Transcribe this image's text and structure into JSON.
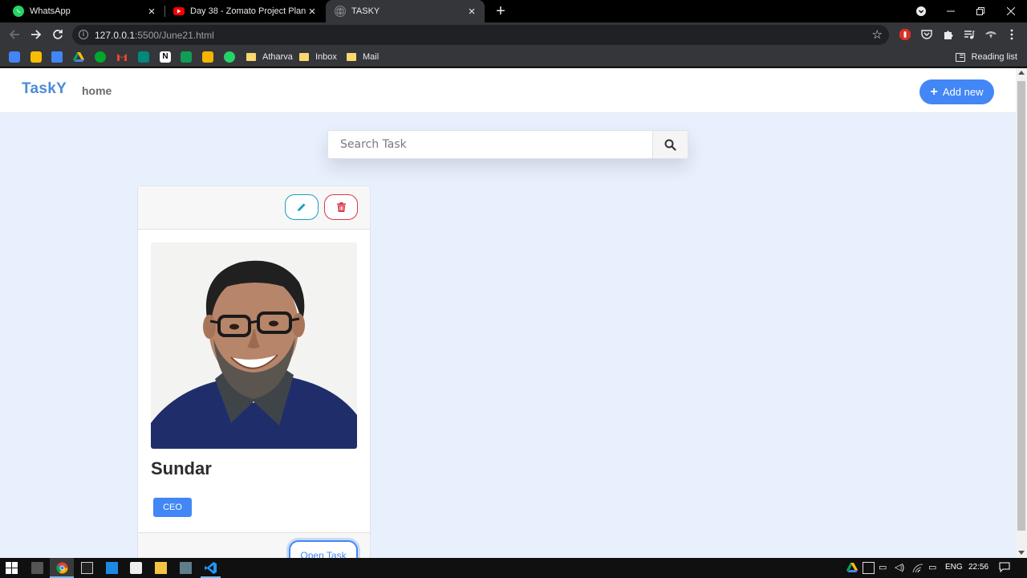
{
  "browser": {
    "tabs": [
      {
        "title": "WhatsApp",
        "icon": "whatsapp-icon"
      },
      {
        "title": "Day 38 - Zomato Project Planning",
        "icon": "youtube-icon"
      },
      {
        "title": "TASKY",
        "icon": "globe-icon",
        "active": true
      }
    ],
    "url_host": "127.0.0.1",
    "url_path": ":5500/June21.html",
    "bookmarks": [
      "Atharva",
      "Inbox",
      "Mail"
    ],
    "reading_list": "Reading list"
  },
  "app": {
    "brand": "TaskY",
    "nav_home": "home",
    "add_new": "Add new",
    "search_placeholder": "Search Task",
    "accent": "#4287f5"
  },
  "card": {
    "title": "Sundar",
    "badge": "CEO",
    "open_button": "Open Task",
    "edit_icon": "pencil-icon",
    "delete_icon": "trash-icon"
  },
  "taskbar": {
    "language": "ENG",
    "time": "22:56"
  }
}
